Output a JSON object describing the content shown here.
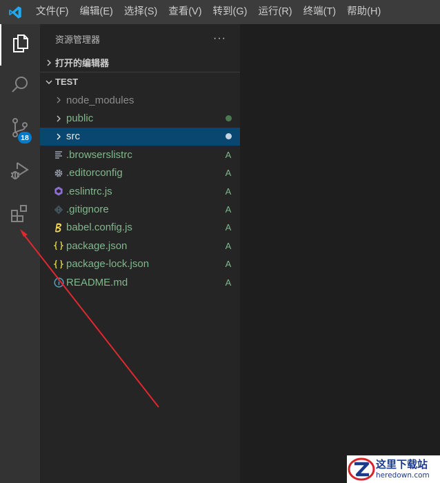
{
  "menu": [
    "文件(F)",
    "编辑(E)",
    "选择(S)",
    "查看(V)",
    "转到(G)",
    "运行(R)",
    "终端(T)",
    "帮助(H)"
  ],
  "activity": {
    "scm_badge": "18"
  },
  "sidebar": {
    "title": "资源管理器",
    "more": "···",
    "open_editors": "打开的编辑器",
    "folder": "TEST",
    "items": [
      {
        "name": "node_modules",
        "status": "",
        "icon": "folder-chevron",
        "color": "#8b8b8b"
      },
      {
        "name": "public",
        "status": "dot",
        "icon": "folder-chevron",
        "color": "#81b88b"
      },
      {
        "name": "src",
        "status": "dot",
        "icon": "folder-chevron",
        "color": "#e7e7e7"
      },
      {
        "name": ".browserslistrc",
        "status": "A",
        "icon": "lines-icon",
        "color": "#81b88b"
      },
      {
        "name": ".editorconfig",
        "status": "A",
        "icon": "gear-icon",
        "color": "#81b88b"
      },
      {
        "name": ".eslintrc.js",
        "status": "A",
        "icon": "eslint-icon",
        "color": "#81b88b"
      },
      {
        "name": ".gitignore",
        "status": "A",
        "icon": "git-icon",
        "color": "#81b88b"
      },
      {
        "name": "babel.config.js",
        "status": "A",
        "icon": "babel-icon",
        "color": "#81b88b"
      },
      {
        "name": "package.json",
        "status": "A",
        "icon": "json-icon",
        "color": "#81b88b"
      },
      {
        "name": "package-lock.json",
        "status": "A",
        "icon": "json-icon",
        "color": "#81b88b"
      },
      {
        "name": "README.md",
        "status": "A",
        "icon": "info-icon",
        "color": "#81b88b"
      }
    ]
  },
  "watermark": {
    "cn": "这里下载站",
    "en": "heredown.com"
  },
  "colors": {
    "titlebar": "#3c3c3c",
    "activitybar": "#333333",
    "sidebar": "#252526",
    "editor": "#1e1e1e",
    "selection": "#094771",
    "accent": "#007acc",
    "git_added": "#81b88b",
    "arrow": "#e0282e"
  }
}
